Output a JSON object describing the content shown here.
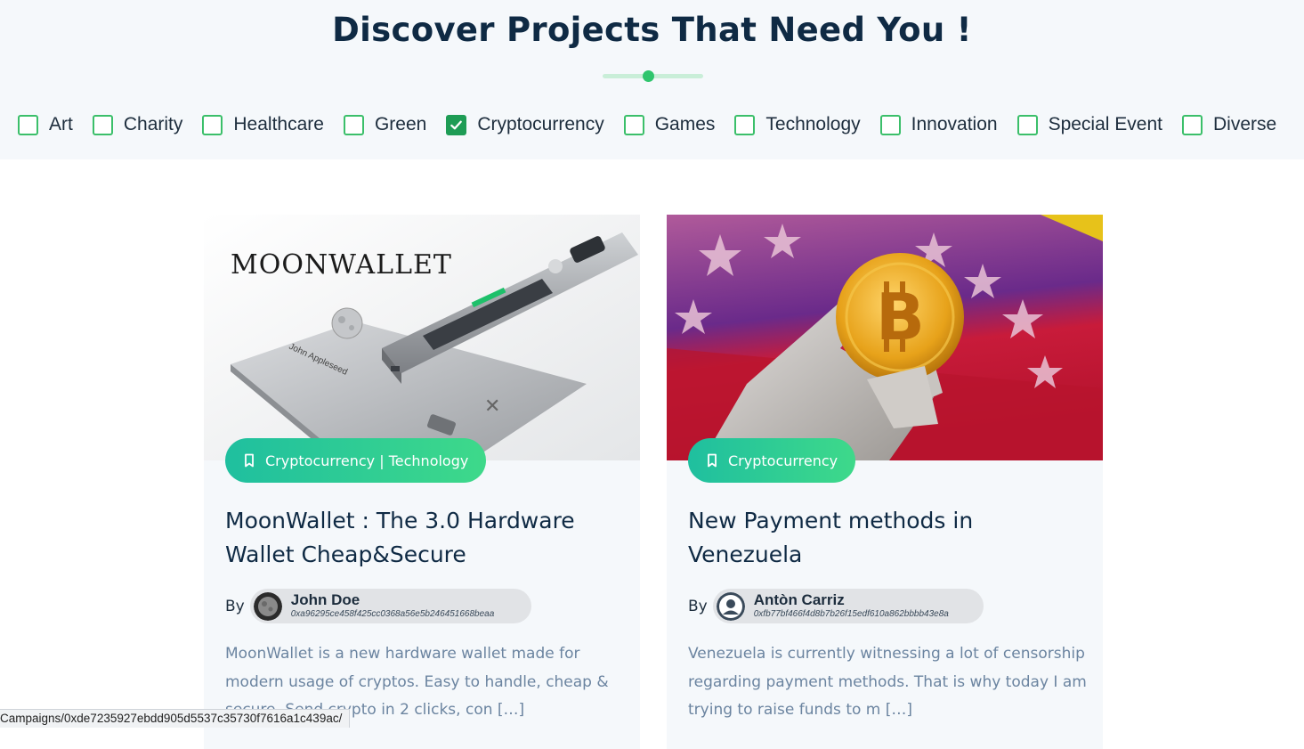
{
  "header": {
    "title": "Discover Projects That Need You !"
  },
  "filters": [
    {
      "label": "Art",
      "checked": false
    },
    {
      "label": "Charity",
      "checked": false
    },
    {
      "label": "Healthcare",
      "checked": false
    },
    {
      "label": "Green",
      "checked": false
    },
    {
      "label": "Cryptocurrency",
      "checked": true
    },
    {
      "label": "Games",
      "checked": false
    },
    {
      "label": "Technology",
      "checked": false
    },
    {
      "label": "Innovation",
      "checked": false
    },
    {
      "label": "Special Event",
      "checked": false
    },
    {
      "label": "Diverse",
      "checked": false
    }
  ],
  "cards": [
    {
      "image_text": "MOONWALLET",
      "image_card_name": "John Appleseed",
      "category": "Cryptocurrency | Technology",
      "title": "MoonWallet : The 3.0 Hardware Wallet Cheap&Secure",
      "by_label": "By",
      "author_name": "John Doe",
      "author_address": "0xa96295ce458f425cc0368a56e5b246451668beaa",
      "excerpt": "MoonWallet is a new hardware wallet made for modern usage of cryptos. Easy to handle, cheap & secure. Send crypto in 2 clicks, con […]"
    },
    {
      "category": "Cryptocurrency",
      "title": "New Payment methods in Venezuela",
      "by_label": "By",
      "author_name": "Antòn Carriz",
      "author_address": "0xfb77bf466f4d8b7b26f15edf610a862bbbb43e8a",
      "excerpt": "Venezuela is currently witnessing a lot of censorship regarding payment methods. That is why today I am trying to raise funds to m […]"
    }
  ],
  "status_bar": {
    "url": "Campaigns/0xde7235927ebdd905d5537c35730f7616a1c439ac/"
  },
  "colors": {
    "accent_green": "#2fc56d",
    "title_navy": "#0f2a44",
    "pill_gradient_start": "#1fbf9f",
    "pill_gradient_end": "#3ed98a",
    "excerpt_text": "#6b84a0"
  },
  "icons": [
    "checkbox-icon",
    "check-icon",
    "bookmark-icon",
    "avatar-icon"
  ]
}
